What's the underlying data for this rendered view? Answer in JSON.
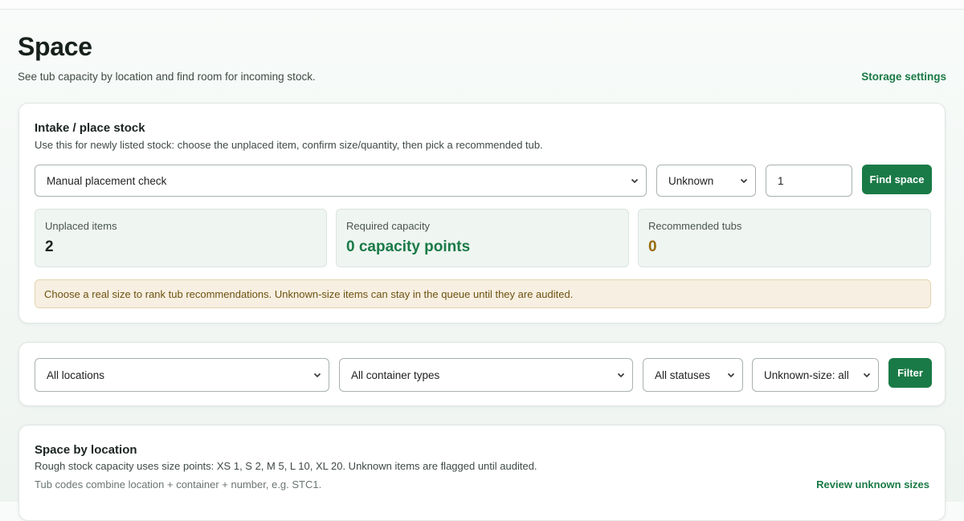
{
  "header": {
    "title": "Space",
    "subtitle": "See tub capacity by location and find room for incoming stock.",
    "settings_link": "Storage settings"
  },
  "intake": {
    "title": "Intake / place stock",
    "subtitle": "Use this for newly listed stock: choose the unplaced item, confirm size/quantity, then pick a recommended tub.",
    "item_select": "Manual placement check",
    "size_select": "Unknown",
    "quantity_value": "1",
    "find_button": "Find space",
    "stats": [
      {
        "label": "Unplaced items",
        "value": "2"
      },
      {
        "label": "Required capacity",
        "value": "0 capacity points"
      },
      {
        "label": "Recommended tubs",
        "value": "0"
      }
    ],
    "notice": "Choose a real size to rank tub recommendations. Unknown-size items can stay in the queue until they are audited."
  },
  "filters": {
    "location": "All locations",
    "container_type": "All container types",
    "status": "All statuses",
    "unknown_size": "Unknown-size: all",
    "filter_button": "Filter"
  },
  "location_section": {
    "title": "Space by location",
    "line1": "Rough stock capacity uses size points: XS 1, S 2, M 5, L 10, XL 20. Unknown items are flagged until audited.",
    "line2": "Tub codes combine location + container + number, e.g. STC1.",
    "review_link": "Review unknown sizes"
  },
  "colors": {
    "accent": "#1a7a47",
    "stat_value_neutral": "#1b241f",
    "stat_value_green": "#1a7a47",
    "stat_value_amber": "#9a6a0c",
    "notice_bg": "#f7efe1"
  }
}
